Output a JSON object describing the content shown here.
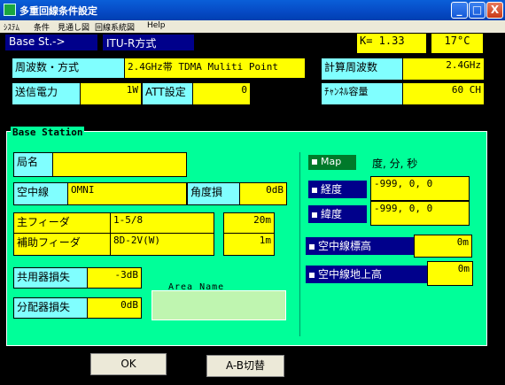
{
  "window": {
    "title": "多重回線条件設定",
    "controls": [
      "_",
      "□",
      "X"
    ]
  },
  "menu": [
    "ｼｽﾃﾑ",
    "条件",
    "見通し図",
    "回線系統図",
    "Help"
  ],
  "top": {
    "station_mode": "Base St.->",
    "method": "ITU-R方式",
    "k_value": "K= 1.33",
    "temperature": "17°C",
    "freq_label": "周波数・方式",
    "freq_value": "2.4GHz帯 TDMA Muliti Point",
    "calc_freq_label": "計算周波数",
    "calc_freq_value": "2.4GHz",
    "power_label": "送信電力",
    "power_value": "1W",
    "att_label": "ATT設定",
    "att_value": "0",
    "channel_label": "ﾁｬﾝﾈﾙ容量",
    "channel_value": "60 CH"
  },
  "base_station": {
    "title": "Base Station",
    "station_name_label": "局名",
    "station_name_value": "",
    "antenna_label": "空中線",
    "antenna_value": "OMNI",
    "angle_loss_label": "角度損",
    "angle_loss_value": "0dB",
    "main_feeder_label": "主フィーダ",
    "main_feeder_type": "1-5/8",
    "main_feeder_len": "20m",
    "aux_feeder_label": "補助フィーダ",
    "aux_feeder_type": "8D-2V(W)",
    "aux_feeder_len": "1m",
    "duplexer_loss_label": "共用器損失",
    "duplexer_loss_value": "-3dB",
    "divider_loss_label": "分配器損失",
    "divider_loss_value": "0dB",
    "area_name_label": "Area Name",
    "area_name_value": "",
    "map_label": "Map",
    "dms_label": "度, 分, 秒",
    "longitude_label": "経度",
    "longitude_value": "-999, 0, 0",
    "latitude_label": "緯度",
    "latitude_value": "-999, 0, 0",
    "antenna_elev_label": "空中線標高",
    "antenna_elev_value": "0m",
    "antenna_agl_label": "空中線地上高",
    "antenna_agl_value": "0m"
  },
  "buttons": {
    "ok": "OK",
    "ab_switch": "A-B切替"
  }
}
